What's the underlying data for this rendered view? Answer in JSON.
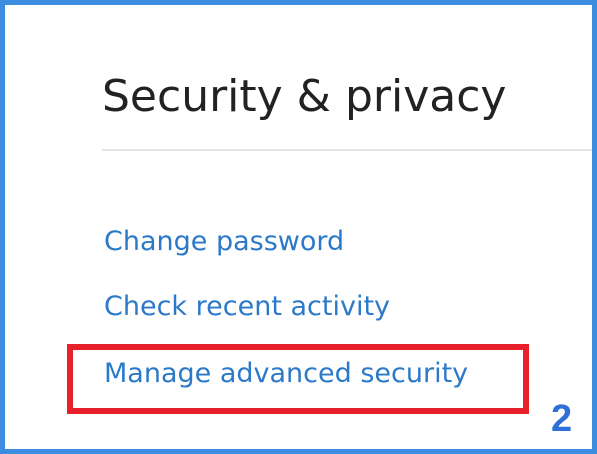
{
  "section": {
    "title": "Security & privacy"
  },
  "links": [
    {
      "label": "Change password"
    },
    {
      "label": "Check recent activity"
    },
    {
      "label": "Manage advanced security"
    }
  ],
  "annotation": {
    "step_number": "2",
    "highlight_color": "#e8202a",
    "badge_color": "#2f6fd8"
  },
  "colors": {
    "frame_border": "#3b8de0",
    "link": "#2b79c8",
    "title": "#222222"
  }
}
